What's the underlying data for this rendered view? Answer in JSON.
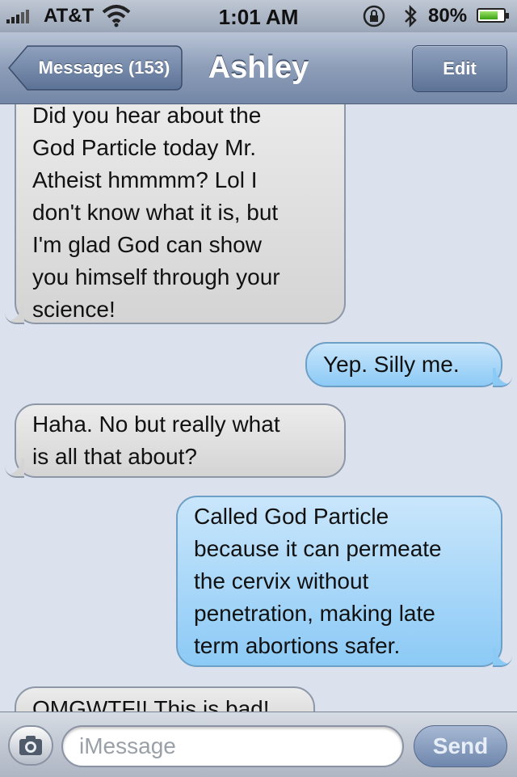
{
  "status_bar": {
    "carrier": "AT&T",
    "time": "1:01 AM",
    "battery_percent": "80%",
    "battery_level": 0.8,
    "icons": [
      "signal-icon",
      "wifi-icon",
      "rotation-lock-icon",
      "bluetooth-icon",
      "battery-icon"
    ]
  },
  "nav": {
    "back_label": "Messages (153)",
    "title": "Ashley",
    "edit_label": "Edit"
  },
  "messages": [
    {
      "from": "them",
      "lines": [
        "Did you hear about the",
        "God Particle today Mr.",
        "Atheist hmmmm?  Lol I",
        "don't know what it is, but",
        "I'm glad God can show",
        "you himself through your",
        "science!"
      ]
    },
    {
      "from": "me",
      "lines": [
        "Yep.  Silly me."
      ]
    },
    {
      "from": "them",
      "lines": [
        "Haha.  No but really what",
        "is all that about?"
      ]
    },
    {
      "from": "me",
      "lines": [
        "Called God Particle",
        "because it can permeate",
        "the cervix without",
        "penetration, making late",
        "term abortions safer."
      ]
    },
    {
      "from": "them",
      "lines": [
        "OMGWTF!! This is bad!"
      ]
    }
  ],
  "input": {
    "placeholder": "iMessage",
    "send_label": "Send"
  },
  "colors": {
    "incoming_bubble": "#e0e0e0",
    "outgoing_bubble": "#a9d6f8",
    "background": "#dbe2ed",
    "nav_bar": "#8d9db8"
  }
}
